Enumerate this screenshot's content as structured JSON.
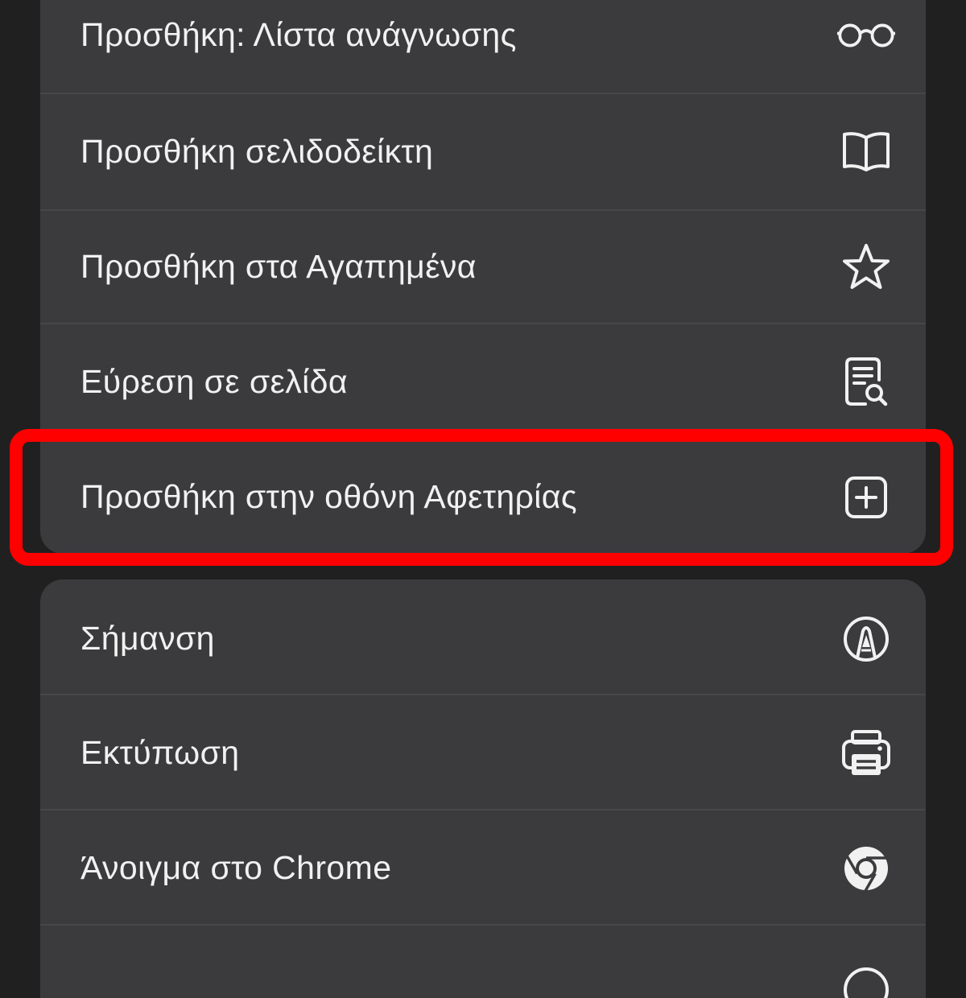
{
  "menu": {
    "group_main": [
      {
        "label": "Προσθήκη: Λίστα ανάγνωσης",
        "icon": "reading-list-glasses-icon"
      },
      {
        "label": "Προσθήκη σελιδοδείκτη",
        "icon": "bookmark-book-icon"
      },
      {
        "label": "Προσθήκη στα Αγαπημένα",
        "icon": "star-icon"
      },
      {
        "label": "Εύρεση σε σελίδα",
        "icon": "find-in-page-icon"
      },
      {
        "label": "Προσθήκη στην οθόνη Αφετηρίας",
        "icon": "add-square-icon"
      }
    ],
    "group_secondary": [
      {
        "label": "Σήμανση",
        "icon": "markup-pen-icon"
      },
      {
        "label": "Εκτύπωση",
        "icon": "printer-icon"
      },
      {
        "label": "Άνοιγμα στο Chrome",
        "icon": "chrome-icon"
      }
    ]
  },
  "colors": {
    "background": "#202020",
    "menu_surface": "#3b3b3d",
    "divider": "#474749",
    "text": "#f1f1f1",
    "highlight_annotation": "#ff0000"
  }
}
